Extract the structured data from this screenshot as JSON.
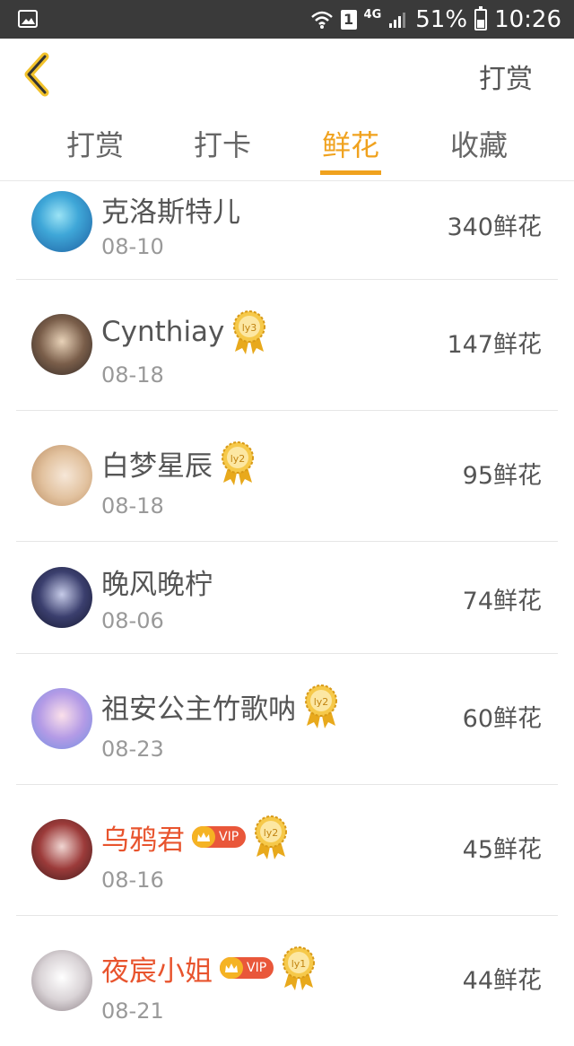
{
  "status_bar": {
    "network": "4G",
    "sim": "1",
    "battery": "51%",
    "battery_level": 0.51,
    "time": "10:26"
  },
  "header": {
    "back_icon": "chevron-left-icon",
    "action": "打赏"
  },
  "tabs": [
    {
      "label": "打赏",
      "active": false
    },
    {
      "label": "打卡",
      "active": false
    },
    {
      "label": "鲜花",
      "active": true
    },
    {
      "label": "收藏",
      "active": false
    }
  ],
  "rows": [
    {
      "name": "克洛斯特儿",
      "date": "08-10",
      "amount": "340鲜花",
      "level": "",
      "vip": false
    },
    {
      "name": "Cynthiay",
      "date": "08-18",
      "amount": "147鲜花",
      "level": "ly3",
      "vip": false
    },
    {
      "name": "白梦星辰",
      "date": "08-18",
      "amount": "95鲜花",
      "level": "ly2",
      "vip": false
    },
    {
      "name": "晚风晚柠",
      "date": "08-06",
      "amount": "74鲜花",
      "level": "",
      "vip": false
    },
    {
      "name": "祖安公主竹歌呐",
      "date": "08-23",
      "amount": "60鲜花",
      "level": "ly2",
      "vip": false
    },
    {
      "name": "乌鸦君",
      "date": "08-16",
      "amount": "45鲜花",
      "level": "ly2",
      "vip": true,
      "vip_label": "VIP"
    },
    {
      "name": "夜宸小姐",
      "date": "08-21",
      "amount": "44鲜花",
      "level": "ly1",
      "vip": true,
      "vip_label": "VIP"
    }
  ],
  "colors": {
    "accent": "#f0a21e",
    "vip_name": "#e8542e",
    "status_bar": "#3a3a3a"
  }
}
